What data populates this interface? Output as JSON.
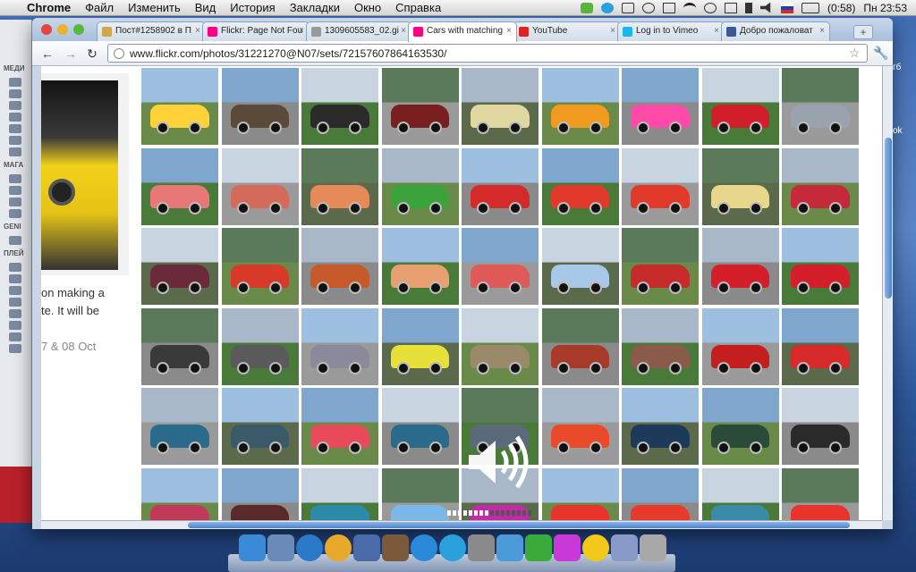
{
  "menubar": {
    "apple": "",
    "app": "Chrome",
    "items": [
      "Файл",
      "Изменить",
      "Вид",
      "История",
      "Закладки",
      "Окно",
      "Справка"
    ],
    "battery": "(0:58)",
    "clock": "Пн 23:53"
  },
  "bg_sidebar": {
    "labels": [
      "МЕДИ",
      "МАГА",
      "GENI",
      "ПЛЕЙ"
    ]
  },
  "tabs": [
    {
      "label": "Пост#1258902 в П",
      "color": "#cfa54e"
    },
    {
      "label": "Flickr: Page Not Fou",
      "color": "#ff0084"
    },
    {
      "label": "1309605583_02.gi",
      "color": "#999999"
    },
    {
      "label": "Cars with matching",
      "color": "#ff0084",
      "active": true
    },
    {
      "label": "YouTube",
      "color": "#dd2222"
    },
    {
      "label": "Log in to Vimeo",
      "color": "#1ab7ea"
    },
    {
      "label": "Добро пожаловат",
      "color": "#3b5998"
    }
  ],
  "newtab": "+",
  "toolbar": {
    "back": "←",
    "forward": "→",
    "reload": "↻",
    "url": "www.flickr.com/photos/31221270@N07/sets/72157607864163530/",
    "star": "☆",
    "wrench": "🔧"
  },
  "left_text": {
    "line1": "on making a",
    "line2": "te. It will be",
    "line3": "7 & 08 Oct"
  },
  "side_labels": {
    "a": "гб",
    "b": "ok"
  },
  "tiles": [
    [
      "#ffd23a",
      "#5b4a3a",
      "#2a2a2a",
      "#7a1f1f",
      "#e0d8a0",
      "#f19a20",
      "#ff4aa8",
      "#d11e2a",
      "#9aa2ad"
    ],
    [
      "#e87878",
      "#d46a5a",
      "#e78a5a",
      "#3aa33a",
      "#d42a2a",
      "#e23a2a",
      "#e23a2a",
      "#e8d78a",
      "#c62a3a"
    ],
    [
      "#6a2a3a",
      "#d83a2a",
      "#c65a2a",
      "#e8a070",
      "#e05a5a",
      "#a8c8e8",
      "#c62a2a",
      "#d41e2a",
      "#d41e2a"
    ],
    [
      "#3a3a3a",
      "#5a5a5a",
      "#8a8a9a",
      "#e8e03a",
      "#9a8a6a",
      "#a83a2a",
      "#8a5a4a",
      "#c41e1e",
      "#d82a2a"
    ],
    [
      "#2a6a8a",
      "#3a5a6a",
      "#e84a5a",
      "#2a6a8a",
      "#5a6a7a",
      "#e84a2a",
      "#1e3a5a",
      "#2a4a3a",
      "#2a2a2a"
    ],
    [
      "#c23a5a",
      "#5a2a2a",
      "#2a8aa8",
      "#7ab8e8",
      "#c42aa8",
      "#e8342a",
      "#e83a2a",
      "#3a8aa8",
      "#e8342a"
    ]
  ],
  "dock": {
    "icons": [
      "finder-icon",
      "preview-icon",
      "globe-icon",
      "chrome-icon",
      "mail-icon",
      "photos-icon",
      "itunes-icon",
      "skype-icon",
      "prefs-icon",
      "mail2-icon",
      "grapher-icon",
      "chat-icon",
      "smile-icon",
      "folder-icon",
      "trash-icon"
    ]
  }
}
